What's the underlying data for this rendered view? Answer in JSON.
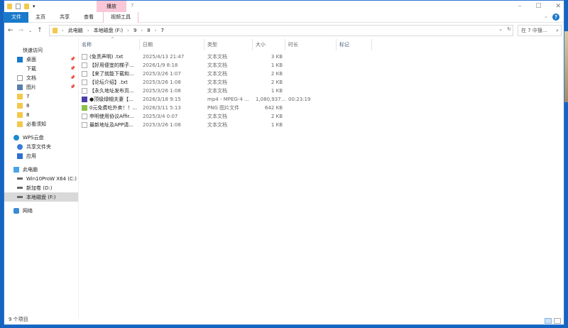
{
  "window": {
    "title": "7",
    "context_tab": "播放"
  },
  "ribbon": {
    "tabs": [
      "文件",
      "主页",
      "共享",
      "查看",
      "视频工具"
    ],
    "help": "?"
  },
  "address": {
    "path": [
      "此电脑",
      "本地磁盘 (F:)",
      "9",
      "8",
      "7"
    ],
    "search_placeholder": "在 7 中搜..."
  },
  "nav": {
    "items": [
      {
        "label": "快速访问",
        "icon": "star-icon",
        "pinned": false,
        "level": 1
      },
      {
        "label": "桌面",
        "icon": "desktop-icon",
        "pinned": true,
        "level": 2
      },
      {
        "label": "下载",
        "icon": "download-icon",
        "pinned": true,
        "level": 2
      },
      {
        "label": "文档",
        "icon": "document-icon",
        "pinned": true,
        "level": 2
      },
      {
        "label": "图片",
        "icon": "pictures-icon",
        "pinned": true,
        "level": 2
      },
      {
        "label": "7",
        "icon": "folder-icon",
        "level": 2
      },
      {
        "label": "8",
        "icon": "folder-icon",
        "level": 2
      },
      {
        "label": "8",
        "icon": "folder-icon",
        "level": 2
      },
      {
        "label": "必看须知",
        "icon": "folder-icon",
        "level": 2
      },
      {
        "label": "WPS云盘",
        "icon": "cloud-icon",
        "level": 1
      },
      {
        "label": "共享文件夹",
        "icon": "share-icon",
        "level": 2
      },
      {
        "label": "应用",
        "icon": "apps-icon",
        "level": 2
      },
      {
        "label": "此电脑",
        "icon": "computer-icon",
        "level": 1
      },
      {
        "label": "Win10ProW X64 (C:)",
        "icon": "drive-icon",
        "level": 2
      },
      {
        "label": "新加卷 (D:)",
        "icon": "drive-icon",
        "level": 2
      },
      {
        "label": "本地磁盘 (F:)",
        "icon": "drive-icon",
        "level": 2,
        "selected": true
      },
      {
        "label": "网络",
        "icon": "network-icon",
        "level": 1
      }
    ]
  },
  "columns": [
    "名称",
    "日期",
    "类型",
    "大小",
    "时长",
    "标记"
  ],
  "files": [
    {
      "name": "(免责声明) .txt",
      "date": "2025/4/13 21:47",
      "type": "文本文档",
      "size": "3 KB",
      "duration": "",
      "icon": "txt"
    },
    {
      "name": "【好用便宜的梯子...",
      "date": "2026/1/9 8:18",
      "type": "文本文档",
      "size": "1 KB",
      "duration": "",
      "icon": "txt"
    },
    {
      "name": "【来了就能下载和...",
      "date": "2025/3/26 1:07",
      "type": "文本文档",
      "size": "2 KB",
      "duration": "",
      "icon": "txt"
    },
    {
      "name": "【论坛介绍】.txt",
      "date": "2025/3/26 1:08",
      "type": "文本文档",
      "size": "2 KB",
      "duration": "",
      "icon": "txt"
    },
    {
      "name": "【永久地址发布页...",
      "date": "2025/3/26 1:08",
      "type": "文本文档",
      "size": "1 KB",
      "duration": "",
      "icon": "txt"
    },
    {
      "name": "●顶级绿帽夫妻【...",
      "date": "2026/3/18 9:15",
      "type": "mp4 - MPEG-4 ...",
      "size": "1,080,937...",
      "duration": "00:23:19",
      "icon": "video"
    },
    {
      "name": "0元免费吃外卖！！...",
      "date": "2026/3/11 5:13",
      "type": "PNG 图片文件",
      "size": "642 KB",
      "duration": "",
      "icon": "png"
    },
    {
      "name": "申明使用协议Affir...",
      "date": "2025/3/4 0:07",
      "type": "文本文档",
      "size": "2 KB",
      "duration": "",
      "icon": "txt"
    },
    {
      "name": "最新地址及APP请...",
      "date": "2025/3/26 1:08",
      "type": "文本文档",
      "size": "1 KB",
      "duration": "",
      "icon": "txt"
    }
  ],
  "status": "9 个项目"
}
